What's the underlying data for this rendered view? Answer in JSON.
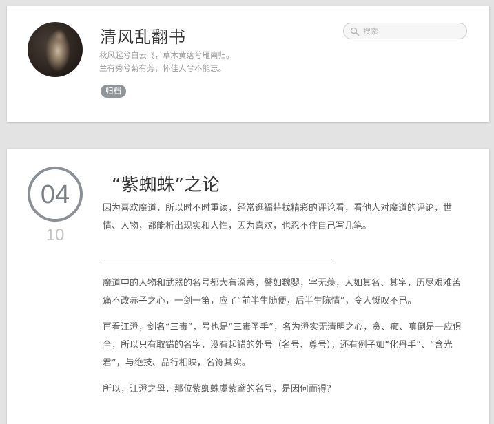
{
  "header": {
    "blog_title": "清风乱翻书",
    "motto_line_1": "秋风起兮白云飞，草木黄落兮雁南归。",
    "motto_line_2": "兰有秀兮菊有芳，怀佳人兮不能忘。",
    "archive_label": "归档",
    "search": {
      "placeholder": "搜索",
      "value": ""
    }
  },
  "post": {
    "date": {
      "day": "04",
      "month": "10"
    },
    "title": "“紫蜘蛛”之论",
    "paragraphs": [
      "因为喜欢魔道，所以时不时重读，经常逛福特找精彩的评论看，看他人对魔道的评论，世情、人物，都能析出现实和人性，因为喜欢，也忍不住自己写几笔。",
      "魔道中的人物和武器的名号都大有深意，譬如魏婴，字无羡，人如其名、其字，历尽艰难苦痛不改赤子之心，一剑一笛，应了“前半生随便，后半生陈情”，令人慨叹不已。",
      "再看江澄，剑名“三毒”，号也是“三毒圣手”，名为澄实无清明之心，贪、痴、嗔倒是一应俱全，所以只有取错的名字，没有起错的外号（名号、尊号），还有例子如“化丹手”、“含光君”，与绝技、品行相映，名符其实。",
      "所以，江澄之母，那位紫蜘蛛虞紫鸢的名号，是因何而得？"
    ]
  },
  "colors": {
    "page_bg": "#e3e3e4",
    "card_bg": "#ffffff",
    "tag_bg": "#8f9599",
    "date_ring": "#8a9095"
  },
  "icons": {
    "search": "search-icon"
  }
}
